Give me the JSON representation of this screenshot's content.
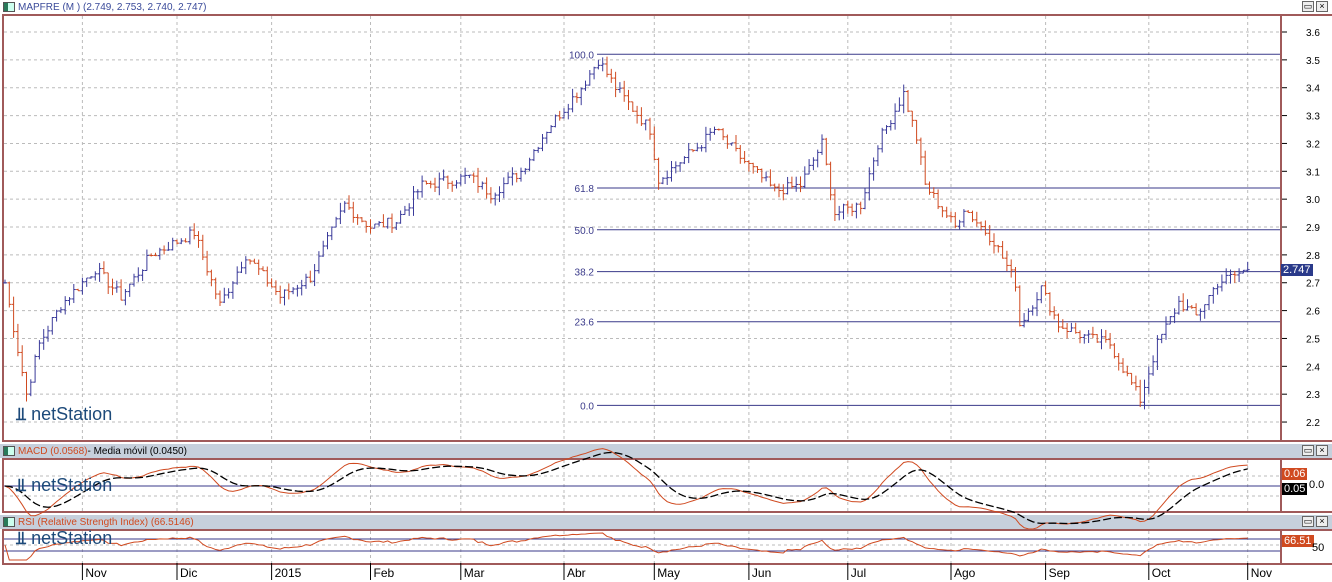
{
  "main": {
    "title": "MAPFRE (M ) (2.749, 2.753, 2.740, 2.747)",
    "last_price": "2.747",
    "watermark": "netStation"
  },
  "macd": {
    "title_a": "MACD (0.0568)",
    "title_b": " - Media móvil (0.0450)",
    "val_macd": "0.06",
    "val_signal": "0.05",
    "zero_label": "0.0",
    "watermark": "netStation"
  },
  "rsi": {
    "title": "RSI (Relative Strength Index) (66.5146)",
    "value": "66.51",
    "mid_label": "50",
    "watermark": "netStation"
  },
  "buttons": {
    "maximize": "▭",
    "close": "×"
  },
  "colors": {
    "up": "#3a3a9a",
    "down": "#d04a20",
    "grid": "#bbbbbb",
    "fib": "#3a3a8a",
    "macd": "#d04a20",
    "signal": "#000000",
    "frame": "#a05a5a"
  },
  "chart_data": {
    "type": "candlestick-bars",
    "title": "MAPFRE (M )",
    "ylim": [
      2.2,
      3.6
    ],
    "yticks": [
      "3.6",
      "3.5",
      "3.4",
      "3.3",
      "3.2",
      "3.1",
      "3.0",
      "2.9",
      "2.8",
      "2.7",
      "2.6",
      "2.5",
      "2.4",
      "2.3",
      "2.2"
    ],
    "xticks": [
      {
        "label": "Nov",
        "day": 18
      },
      {
        "label": "Dic",
        "day": 40
      },
      {
        "label": "2015",
        "day": 62
      },
      {
        "label": "Feb",
        "day": 85
      },
      {
        "label": "Mar",
        "day": 106
      },
      {
        "label": "Abr",
        "day": 130
      },
      {
        "label": "May",
        "day": 151
      },
      {
        "label": "Jun",
        "day": 173
      },
      {
        "label": "Jul",
        "day": 196
      },
      {
        "label": "Ago",
        "day": 220
      },
      {
        "label": "Sep",
        "day": 242
      },
      {
        "label": "Oct",
        "day": 266
      },
      {
        "label": "Nov",
        "day": 289
      }
    ],
    "close_anchors": [
      [
        0,
        2.7
      ],
      [
        5,
        2.3
      ],
      [
        8,
        2.48
      ],
      [
        13,
        2.62
      ],
      [
        21,
        2.75
      ],
      [
        27,
        2.65
      ],
      [
        34,
        2.8
      ],
      [
        44,
        2.88
      ],
      [
        50,
        2.62
      ],
      [
        56,
        2.8
      ],
      [
        64,
        2.65
      ],
      [
        71,
        2.72
      ],
      [
        79,
        2.98
      ],
      [
        85,
        2.9
      ],
      [
        91,
        2.92
      ],
      [
        97,
        3.05
      ],
      [
        108,
        3.08
      ],
      [
        113,
        3.02
      ],
      [
        120,
        3.1
      ],
      [
        126,
        3.25
      ],
      [
        134,
        3.4
      ],
      [
        138,
        3.5
      ],
      [
        142,
        3.4
      ],
      [
        150,
        3.25
      ],
      [
        152,
        3.07
      ],
      [
        162,
        3.2
      ],
      [
        165,
        3.25
      ],
      [
        171,
        3.15
      ],
      [
        179,
        3.03
      ],
      [
        185,
        3.05
      ],
      [
        190,
        3.2
      ],
      [
        193,
        2.95
      ],
      [
        199,
        2.98
      ],
      [
        203,
        3.2
      ],
      [
        209,
        3.38
      ],
      [
        212,
        3.22
      ],
      [
        214,
        3.05
      ],
      [
        221,
        2.9
      ],
      [
        223,
        2.97
      ],
      [
        230,
        2.85
      ],
      [
        235,
        2.7
      ],
      [
        236,
        2.55
      ],
      [
        241,
        2.68
      ],
      [
        245,
        2.55
      ],
      [
        252,
        2.5
      ],
      [
        257,
        2.48
      ],
      [
        264,
        2.28
      ],
      [
        268,
        2.48
      ],
      [
        273,
        2.63
      ],
      [
        277,
        2.58
      ],
      [
        282,
        2.7
      ],
      [
        289,
        2.747
      ]
    ],
    "fibonacci": [
      {
        "label": "100.0",
        "price": 3.52
      },
      {
        "label": "61.8",
        "price": 3.04
      },
      {
        "label": "50.0",
        "price": 2.89
      },
      {
        "label": "38.2",
        "price": 2.74
      },
      {
        "label": "23.6",
        "price": 2.56
      },
      {
        "label": "0.0",
        "price": 2.26
      }
    ]
  }
}
